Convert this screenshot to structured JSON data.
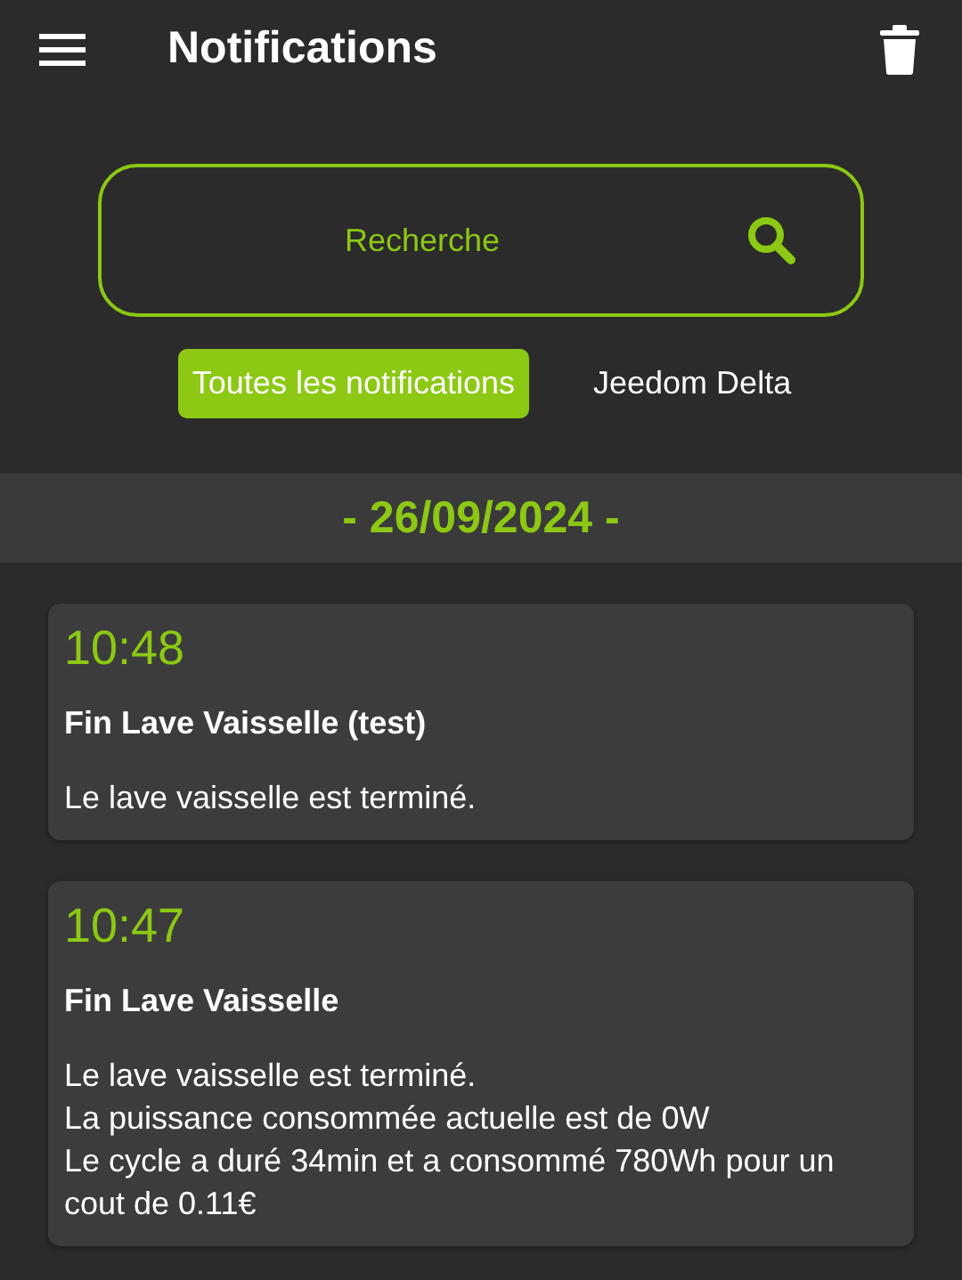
{
  "header": {
    "title": "Notifications"
  },
  "search": {
    "placeholder": "Recherche"
  },
  "filters": [
    {
      "label": "Toutes les notifications",
      "selected": true
    },
    {
      "label": "Jeedom Delta",
      "selected": false
    }
  ],
  "date": "- 26/09/2024 -",
  "notifications": [
    {
      "time": "10:48",
      "title": "Fin Lave Vaisselle (test)",
      "lines": [
        "Le lave vaisselle est terminé."
      ]
    },
    {
      "time": "10:47",
      "title": "Fin Lave Vaisselle",
      "lines": [
        "Le lave vaisselle est terminé.",
        "La puissance consommée actuelle est de 0W",
        "Le cycle a duré 34min et a consommé 780Wh pour un cout de 0.11€"
      ]
    }
  ]
}
